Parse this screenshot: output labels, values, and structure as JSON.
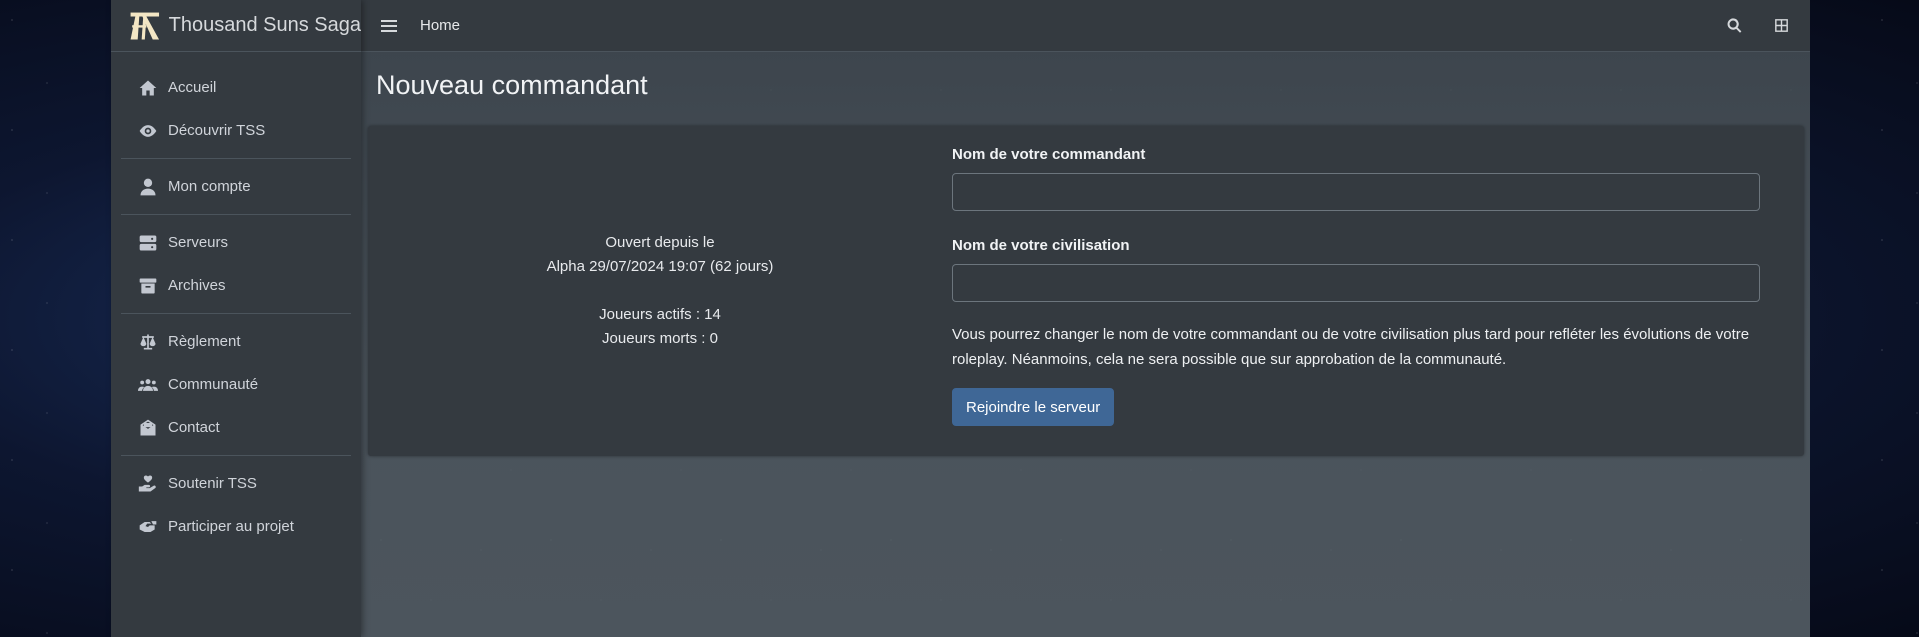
{
  "brand": {
    "name": "Thousand Suns Saga",
    "logo_icon": "tss-logo-icon"
  },
  "colors": {
    "sidebar": "#343a40",
    "content": "#454d55",
    "accent": "#3f6796",
    "border": "#4b545c"
  },
  "sidebar": {
    "groups": [
      [
        {
          "label": "Accueil",
          "icon": "home-icon"
        },
        {
          "label": "Découvrir TSS",
          "icon": "eye-icon"
        }
      ],
      [
        {
          "label": "Mon compte",
          "icon": "user-icon"
        }
      ],
      [
        {
          "label": "Serveurs",
          "icon": "server-icon"
        },
        {
          "label": "Archives",
          "icon": "archive-icon"
        }
      ],
      [
        {
          "label": "Règlement",
          "icon": "scale-icon"
        },
        {
          "label": "Communauté",
          "icon": "users-icon"
        },
        {
          "label": "Contact",
          "icon": "envelope-open-icon"
        }
      ],
      [
        {
          "label": "Soutenir TSS",
          "icon": "hand-holding-heart-icon"
        },
        {
          "label": "Participer au projet",
          "icon": "hands-helping-icon"
        }
      ]
    ]
  },
  "topbar": {
    "home_label": "Home",
    "menu_icon": "hamburger-icon",
    "search_icon": "search-icon",
    "grid_icon": "grid-icon"
  },
  "page": {
    "title": "Nouveau commandant"
  },
  "server_info": {
    "opened_label": "Ouvert depuis le",
    "opened_value": "Alpha 29/07/2024 19:07 (62 jours)",
    "active_players": "Joueurs actifs : 14",
    "dead_players": "Joueurs morts : 0"
  },
  "form": {
    "commander_label": "Nom de votre commandant",
    "commander_value": "",
    "civilization_label": "Nom de votre civilisation",
    "civilization_value": "",
    "help_text": "Vous pourrez changer le nom de votre commandant ou de votre civilisation plus tard pour refléter les évolutions de votre roleplay. Néanmoins, cela ne sera possible que sur approbation de la communauté.",
    "submit_label": "Rejoindre le serveur"
  }
}
